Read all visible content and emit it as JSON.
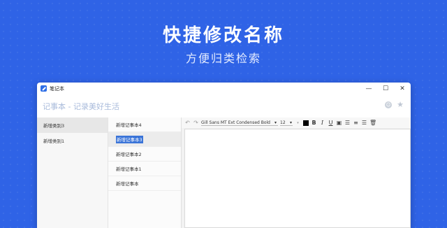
{
  "promo": {
    "title": "快捷修改名称",
    "subtitle": "方便归类检索"
  },
  "window": {
    "app_title": "笔记本",
    "controls": {
      "minimize": "—",
      "maximize": "☐",
      "close": "✕"
    }
  },
  "header": {
    "title": "记事本 - 记录美好生活"
  },
  "categories": [
    {
      "label": "新增类别3"
    },
    {
      "label": "新增类别1"
    }
  ],
  "notes": [
    {
      "label": "新增记事本4"
    },
    {
      "label": "新增记事本3"
    },
    {
      "label": "新增记事本2"
    },
    {
      "label": "新增记事本1"
    },
    {
      "label": "新增记事本"
    }
  ],
  "toolbar": {
    "font_family": "Gill Sans MT Ext Condensed Bold",
    "font_size": "12",
    "dropdown_arrow": "▾",
    "bold": "B",
    "italic": "I",
    "underline": "U",
    "text_color": "#000000"
  }
}
